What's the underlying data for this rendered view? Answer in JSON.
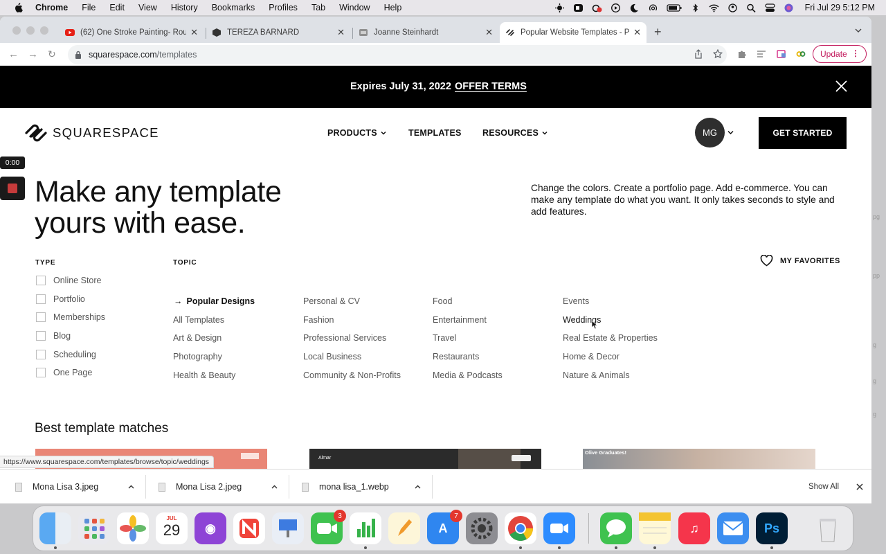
{
  "menubar": {
    "app_name": "Chrome",
    "menus": [
      "File",
      "Edit",
      "View",
      "History",
      "Bookmarks",
      "Profiles",
      "Tab",
      "Window",
      "Help"
    ],
    "clock": "Fri Jul 29  5:12 PM"
  },
  "tabs": [
    {
      "title": "(62) One Stroke Painting- Rou",
      "favicon": "youtube-icon"
    },
    {
      "title": "TEREZA BARNARD",
      "favicon": "cube-icon"
    },
    {
      "title": "Joanne Steinhardt",
      "favicon": "site-icon"
    },
    {
      "title": "Popular Website Templates - P",
      "favicon": "squarespace-icon",
      "active": true
    }
  ],
  "address": {
    "host": "squarespace.com",
    "path": "/templates"
  },
  "update_label": "Update",
  "promo": {
    "expires": "Expires July 31, 2022",
    "offer": "OFFER TERMS"
  },
  "site_nav": {
    "wordmark": "SQUARESPACE",
    "links": [
      "PRODUCTS",
      "TEMPLATES",
      "RESOURCES"
    ],
    "avatar_initials": "MG",
    "cta": "GET STARTED"
  },
  "recorder": {
    "time": "0:00"
  },
  "hero": {
    "title_line1": "Make any template",
    "title_line2": "yours with ease.",
    "description": "Change the colors. Create a portfolio page. Add e-commerce. You can make any template do what you want. It only takes seconds to style and add features."
  },
  "filters": {
    "type_heading": "TYPE",
    "topic_heading": "TOPIC",
    "types": [
      "Online Store",
      "Portfolio",
      "Memberships",
      "Blog",
      "Scheduling",
      "One Page"
    ],
    "topics_col1": [
      "Popular Designs",
      "All Templates",
      "Art & Design",
      "Photography",
      "Health & Beauty"
    ],
    "topics_col2": [
      "Personal & CV",
      "Fashion",
      "Professional Services",
      "Local Business",
      "Community & Non-Profits"
    ],
    "topics_col3": [
      "Food",
      "Entertainment",
      "Travel",
      "Restaurants",
      "Media & Podcasts"
    ],
    "topics_col4": [
      "Events",
      "Weddings",
      "Real Estate & Properties",
      "Home & Decor",
      "Nature & Animals"
    ],
    "favorites_label": "MY FAVORITES"
  },
  "best_matches": {
    "title": "Best template matches",
    "thumb2_brand": "Almar",
    "thumb3_caption": "Olive Graduates!"
  },
  "status_url": "https://www.squarespace.com/templates/browse/topic/weddings",
  "downloads": {
    "items": [
      "Mona Lisa 3.jpeg",
      "Mona Lisa 2.jpeg",
      "mona lisa_1.webp"
    ],
    "show_all": "Show All"
  },
  "dock": {
    "calendar_month": "JUL",
    "calendar_day": "29",
    "facetime_badge": "3",
    "appstore_badge": "7"
  },
  "desktop_fragments": [
    "pg",
    "pp",
    "g",
    "g",
    "g"
  ]
}
